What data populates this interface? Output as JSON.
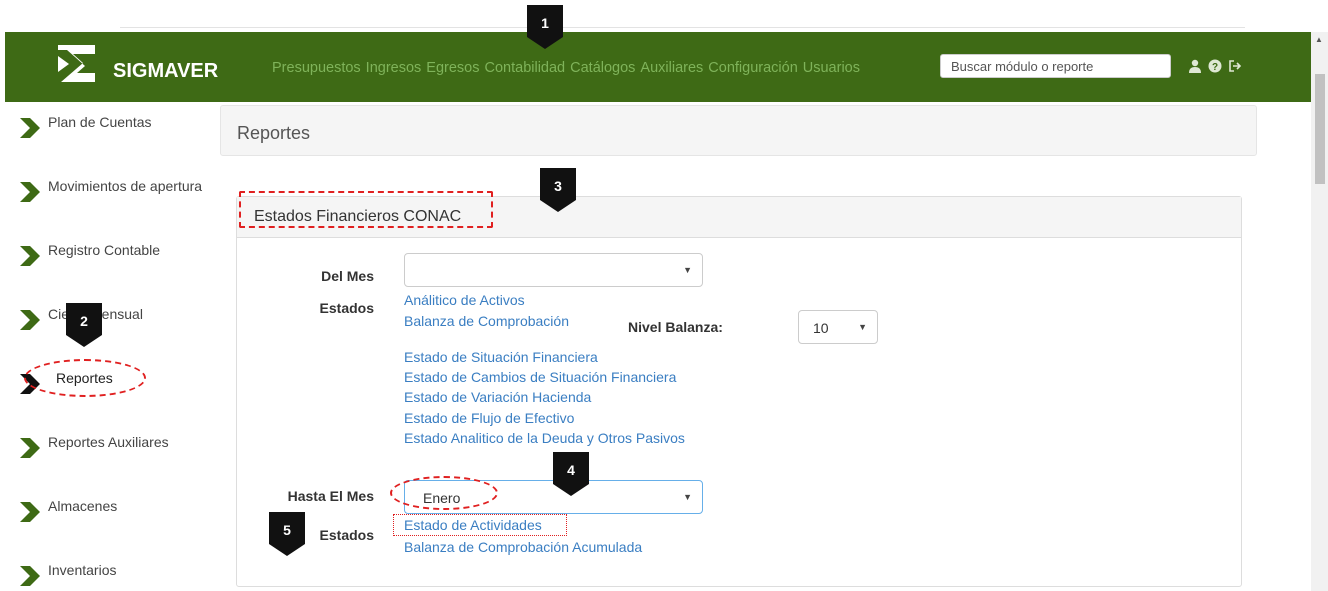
{
  "brand": "SIGMAVER",
  "menu": [
    "Presupuestos",
    "Ingresos",
    "Egresos",
    "Contabilidad",
    "Catálogos",
    "Auxiliares",
    "Configuración",
    "Usuarios"
  ],
  "search": {
    "placeholder": "Buscar módulo o reporte"
  },
  "nav_icons": [
    "user-icon",
    "help-icon",
    "logout-icon"
  ],
  "sidebar": {
    "items": [
      {
        "label": "Plan de Cuentas"
      },
      {
        "label": "Movimientos de apertura"
      },
      {
        "label": "Registro Contable"
      },
      {
        "label": "Cierre Mensual"
      },
      {
        "label": "Reportes",
        "active": true
      },
      {
        "label": "Reportes Auxiliares"
      },
      {
        "label": "Almacenes"
      },
      {
        "label": "Inventarios"
      }
    ]
  },
  "page": {
    "title": "Reportes"
  },
  "panel": {
    "title": "Estados Financieros CONAC",
    "del_mes": {
      "label": "Del Mes",
      "value": ""
    },
    "estados_label": "Estados",
    "links1": [
      "Análitico de Activos",
      "Balanza de Comprobación",
      "Estado de Situación Financiera",
      "Estado de Cambios de Situación Financiera",
      "Estado de Variación Hacienda",
      "Estado de Flujo de Efectivo",
      "Estado Analitico de la Deuda y Otros Pasivos"
    ],
    "nivel_balanza": {
      "label": "Nivel Balanza:",
      "value": "10"
    },
    "hasta_mes": {
      "label": "Hasta El Mes",
      "value": "Enero"
    },
    "estados2_label": "Estados",
    "links2": [
      "Estado de Actividades",
      "Balanza de Comprobación Acumulada"
    ]
  },
  "annotations": [
    "1",
    "2",
    "3",
    "4",
    "5"
  ],
  "colors": {
    "navbar": "#3e6a15",
    "link": "#3a7ec2",
    "highlight": "#e02020",
    "chevron": "#3e6a15"
  }
}
